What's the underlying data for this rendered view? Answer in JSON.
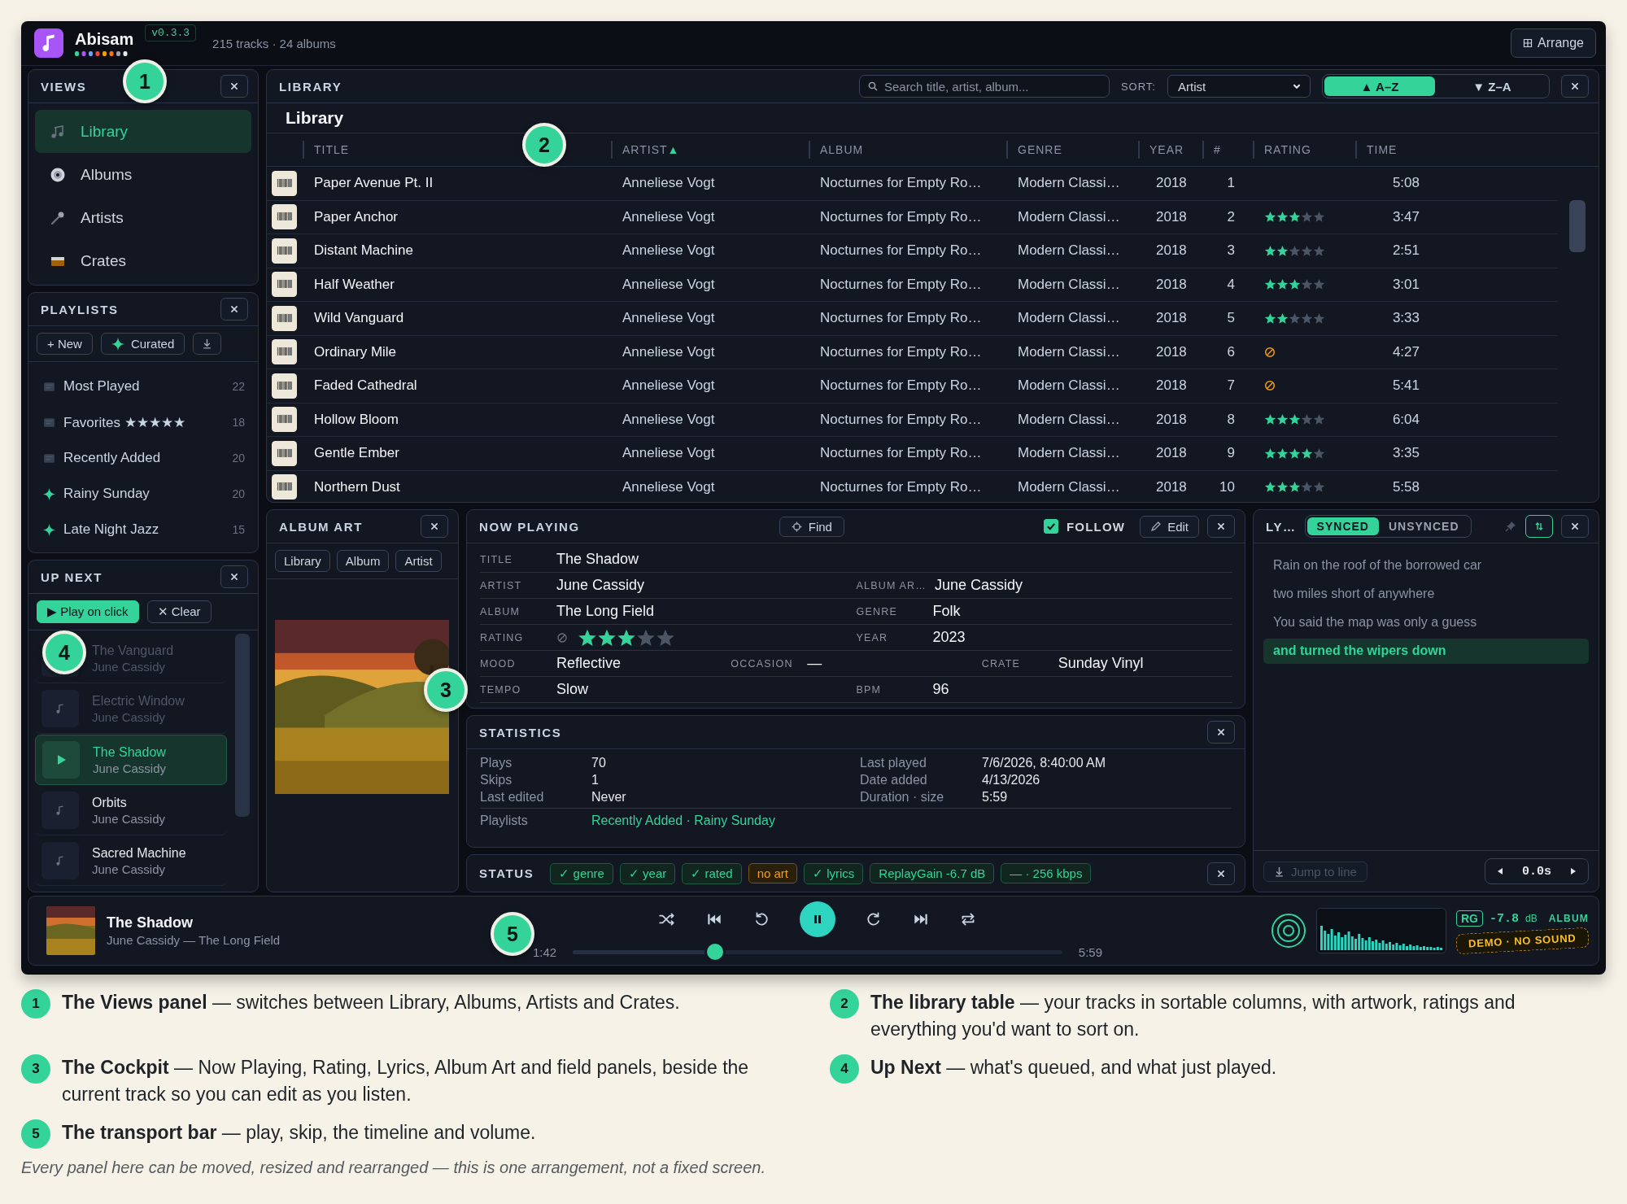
{
  "app": {
    "name": "Abisam",
    "version": "v0.3.3",
    "summary": "215 tracks · 24 albums",
    "arrange": "Arrange"
  },
  "views": {
    "title": "VIEWS",
    "items": [
      {
        "label": "Library",
        "selected": true
      },
      {
        "label": "Albums",
        "selected": false
      },
      {
        "label": "Artists",
        "selected": false
      },
      {
        "label": "Crates",
        "selected": false
      }
    ]
  },
  "playlists": {
    "title": "PLAYLISTS",
    "new_button": "+ New",
    "curated_button": "Curated",
    "items": [
      {
        "name": "Most Played",
        "count": "22",
        "kind": "smart"
      },
      {
        "name": "Favorites ★★★★★",
        "count": "18",
        "kind": "smart"
      },
      {
        "name": "Recently Added",
        "count": "20",
        "kind": "smart"
      },
      {
        "name": "Rainy Sunday",
        "count": "20",
        "kind": "curated"
      },
      {
        "name": "Late Night Jazz",
        "count": "15",
        "kind": "curated"
      }
    ]
  },
  "up_next": {
    "title": "UP NEXT",
    "play_on_click": {
      "label": "▶ Play on click",
      "on": true
    },
    "clear": "✕ Clear",
    "tracks": [
      {
        "title": "The Vanguard",
        "artist": "June Cassidy",
        "kind": "played"
      },
      {
        "title": "Electric Window",
        "artist": "June Cassidy",
        "kind": "played"
      },
      {
        "title": "The Shadow",
        "artist": "June Cassidy",
        "kind": "current"
      },
      {
        "title": "Orbits",
        "artist": "June Cassidy",
        "kind": "queued"
      },
      {
        "title": "Sacred Machine",
        "artist": "June Cassidy",
        "kind": "queued"
      }
    ]
  },
  "library": {
    "panel_title": "LIBRARY",
    "heading": "Library",
    "search_placeholder": "Search title, artist, album...",
    "sort_label": "SORT:",
    "sort_value": "Artist",
    "sort_arrow": "▲",
    "order": [
      {
        "label": "▲ A–Z",
        "selected": true
      },
      {
        "label": "▼ Z–A",
        "selected": false
      }
    ],
    "columns": [
      {
        "label": "TITLE",
        "sorted": false
      },
      {
        "label": "ARTIST",
        "sorted": true
      },
      {
        "label": "ALBUM",
        "sorted": false
      },
      {
        "label": "GENRE",
        "sorted": false
      },
      {
        "label": "YEAR",
        "sorted": false
      },
      {
        "label": "#",
        "sorted": false
      },
      {
        "label": "RATING",
        "sorted": false
      },
      {
        "label": "TIME",
        "sorted": false
      }
    ],
    "rows": [
      {
        "title": "Paper Avenue Pt. II",
        "artist": "Anneliese Vogt",
        "album": "Nocturnes for Empty Ro…",
        "genre": "Modern Classi…",
        "year": "2018",
        "number": "1",
        "kind": "blank",
        "time": "5:08"
      },
      {
        "title": "Paper Anchor",
        "artist": "Anneliese Vogt",
        "album": "Nocturnes for Empty Ro…",
        "genre": "Modern Classi…",
        "year": "2018",
        "number": "2",
        "kind": "stars",
        "stars": 3,
        "time": "3:47"
      },
      {
        "title": "Distant Machine",
        "artist": "Anneliese Vogt",
        "album": "Nocturnes for Empty Ro…",
        "genre": "Modern Classi…",
        "year": "2018",
        "number": "3",
        "kind": "stars",
        "stars": 2,
        "time": "2:51"
      },
      {
        "title": "Half Weather",
        "artist": "Anneliese Vogt",
        "album": "Nocturnes for Empty Ro…",
        "genre": "Modern Classi…",
        "year": "2018",
        "number": "4",
        "kind": "stars",
        "stars": 3,
        "time": "3:01"
      },
      {
        "title": "Wild Vanguard",
        "artist": "Anneliese Vogt",
        "album": "Nocturnes for Empty Ro…",
        "genre": "Modern Classi…",
        "year": "2018",
        "number": "5",
        "kind": "stars",
        "stars": 2,
        "time": "3:33"
      },
      {
        "title": "Ordinary Mile",
        "artist": "Anneliese Vogt",
        "album": "Nocturnes for Empty Ro…",
        "genre": "Modern Classi…",
        "year": "2018",
        "number": "6",
        "kind": "blocked",
        "time": "4:27"
      },
      {
        "title": "Faded Cathedral",
        "artist": "Anneliese Vogt",
        "album": "Nocturnes for Empty Ro…",
        "genre": "Modern Classi…",
        "year": "2018",
        "number": "7",
        "kind": "blocked",
        "time": "5:41"
      },
      {
        "title": "Hollow Bloom",
        "artist": "Anneliese Vogt",
        "album": "Nocturnes for Empty Ro…",
        "genre": "Modern Classi…",
        "year": "2018",
        "number": "8",
        "kind": "stars",
        "stars": 3,
        "time": "6:04"
      },
      {
        "title": "Gentle Ember",
        "artist": "Anneliese Vogt",
        "album": "Nocturnes for Empty Ro…",
        "genre": "Modern Classi…",
        "year": "2018",
        "number": "9",
        "kind": "stars",
        "stars": 4,
        "time": "3:35"
      },
      {
        "title": "Northern Dust",
        "artist": "Anneliese Vogt",
        "album": "Nocturnes for Empty Ro…",
        "genre": "Modern Classi…",
        "year": "2018",
        "number": "10",
        "kind": "stars",
        "stars": 3,
        "time": "5:58"
      }
    ]
  },
  "album_art": {
    "title": "ALBUM ART",
    "buttons": [
      "Library",
      "Album",
      "Artist"
    ]
  },
  "now_playing": {
    "title": "NOW PLAYING",
    "find": "Find",
    "follow": {
      "label": "FOLLOW",
      "checked": true
    },
    "edit": "Edit",
    "rows": [
      [
        {
          "label": "TITLE",
          "value": "The Shadow",
          "kind": "text"
        }
      ],
      [
        {
          "label": "ARTIST",
          "value": "June Cassidy",
          "kind": "text"
        },
        {
          "label": "ALBUM AR…",
          "value": "June Cassidy",
          "kind": "text"
        }
      ],
      [
        {
          "label": "ALBUM",
          "value": "The Long Field",
          "kind": "text"
        },
        {
          "label": "GENRE",
          "value": "Folk",
          "kind": "text"
        }
      ],
      [
        {
          "label": "RATING",
          "kind": "rating",
          "stars": 3
        },
        {
          "label": "YEAR",
          "value": "2023",
          "kind": "text"
        }
      ],
      [
        {
          "label": "MOOD",
          "value": "Reflective",
          "kind": "text"
        },
        {
          "label": "OCCASION",
          "value": "—",
          "kind": "text"
        },
        {
          "label": "CRATE",
          "value": "Sunday Vinyl",
          "kind": "text"
        }
      ],
      [
        {
          "label": "TEMPO",
          "value": "Slow",
          "kind": "text"
        },
        {
          "label": "BPM",
          "value": "96",
          "kind": "text"
        }
      ]
    ]
  },
  "statistics": {
    "title": "STATISTICS",
    "left": [
      {
        "label": "Plays",
        "value": "70"
      },
      {
        "label": "Skips",
        "value": "1"
      },
      {
        "label": "Last edited",
        "value": "Never"
      }
    ],
    "right": [
      {
        "label": "Last played",
        "value": "7/6/2026, 8:40:00 AM"
      },
      {
        "label": "Date added",
        "value": "4/13/2026"
      },
      {
        "label": "Duration · size",
        "value": "5:59"
      }
    ],
    "playlists_label": "Playlists",
    "playlists_value": "Recently Added · Rainy Sunday"
  },
  "status": {
    "title": "STATUS",
    "chips": [
      {
        "label": "✓ genre",
        "kind": "ok"
      },
      {
        "label": "✓ year",
        "kind": "ok"
      },
      {
        "label": "✓ rated",
        "kind": "ok"
      },
      {
        "label": "no art",
        "kind": "warn"
      },
      {
        "label": "✓ lyrics",
        "kind": "ok"
      },
      {
        "label": "ReplayGain -6.7 dB",
        "kind": "ok"
      },
      {
        "label": "— · 256 kbps",
        "kind": "ok"
      }
    ]
  },
  "lyrics": {
    "title": "LY…",
    "modes": [
      {
        "label": "SYNCED",
        "selected": true
      },
      {
        "label": "UNSYNCED",
        "selected": false
      }
    ],
    "lines": [
      {
        "text": "Rain on the roof of the borrowed car",
        "selected": false
      },
      {
        "text": "two miles short of anywhere",
        "selected": false
      },
      {
        "text": "You said the map was only a guess",
        "selected": false
      },
      {
        "text": "and turned the wipers down",
        "selected": true
      }
    ],
    "jump": {
      "label": "Jump to line",
      "disabled": true
    },
    "offset": "0.0s"
  },
  "transport": {
    "title": "The Shadow",
    "subtitle": "June Cassidy — The Long Field",
    "elapsed": "1:42",
    "duration": "5:59",
    "level": 0.29,
    "playing": true,
    "rg_badge": "RG",
    "gain": "-7.8",
    "gain_unit": "dB",
    "gain_mode": "ALBUM",
    "demo_badge": "DEMO · NO SOUND"
  },
  "callouts": [
    "1",
    "2",
    "3",
    "4",
    "5"
  ],
  "captions": [
    {
      "number": "1",
      "text": "**The Views panel** — switches between Library, Albums, Artists and Crates."
    },
    {
      "number": "2",
      "text": "**The library table** — your tracks in sortable columns, with artwork, ratings and everything you'd want to sort on."
    },
    {
      "number": "3",
      "text": "**The Cockpit** — Now Playing, Rating, Lyrics, Album Art and field panels, beside the current track so you can edit as you listen."
    },
    {
      "number": "4",
      "text": "**Up Next** — what's queued, and what just played."
    },
    {
      "number": "5",
      "text": "**The transport bar** — play, skip, the timeline and volume."
    }
  ],
  "footnote": "Every panel here can be moved, resized and rearranged — this is one arrangement, not a fixed screen."
}
